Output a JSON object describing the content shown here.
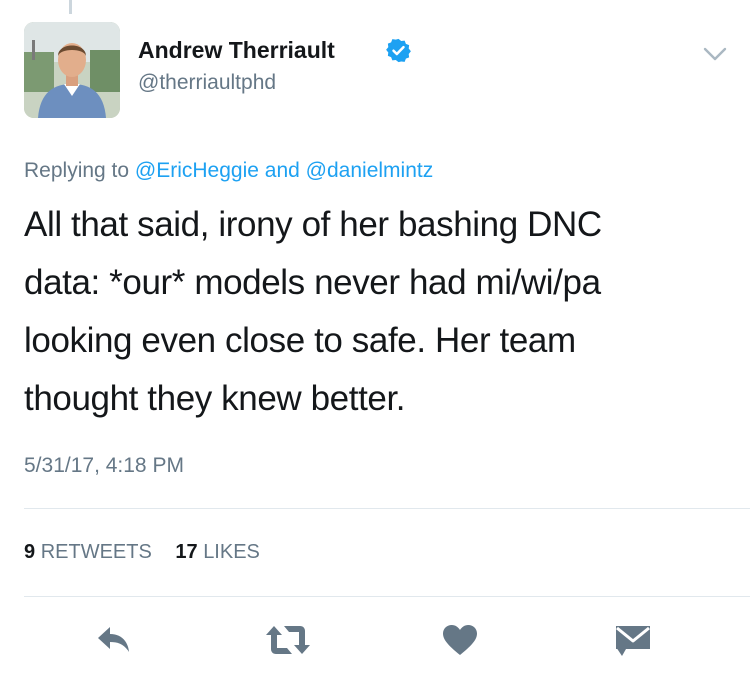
{
  "author": {
    "display_name": "Andrew Therriault",
    "handle": "@therriaultphd",
    "verified": true,
    "avatar_icon": "profile-photo"
  },
  "reply_context": {
    "prefix": "Replying to",
    "mention_1": "@EricHeggie",
    "conjunction": "and",
    "mention_2": "@danielmintz"
  },
  "tweet": {
    "text": "All that said, irony of her bashing DNC\ndata: *our* models never had mi/wi/pa\nlooking even close to safe. Her team\nthought they knew better.",
    "timestamp": "5/31/17, 4:18 PM"
  },
  "stats": {
    "retweets_count": "9",
    "retweets_label": "RETWEETS",
    "likes_count": "17",
    "likes_label": "LIKES"
  },
  "actions": [
    {
      "name": "reply",
      "icon": "reply-icon"
    },
    {
      "name": "retweet",
      "icon": "retweet-icon"
    },
    {
      "name": "like",
      "icon": "heart-icon"
    },
    {
      "name": "message",
      "icon": "envelope-icon"
    }
  ],
  "colors": {
    "link": "#1da1f2",
    "secondary_text": "#657786",
    "primary_text": "#14171a",
    "action_icon": "#657786",
    "divider": "#e1e8ed"
  }
}
